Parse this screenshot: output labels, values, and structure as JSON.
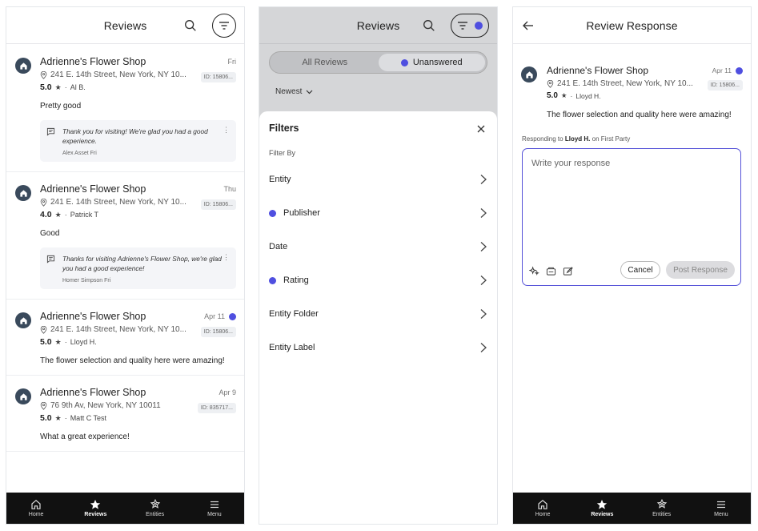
{
  "colors": {
    "accent": "#4f4fe0",
    "nav_bg": "#111111",
    "avatar_bg": "#3a4a5c"
  },
  "nav": [
    {
      "label": "Home",
      "icon": "home-icon"
    },
    {
      "label": "Reviews",
      "icon": "star-icon",
      "active": true
    },
    {
      "label": "Entities",
      "icon": "entities-icon"
    },
    {
      "label": "Menu",
      "icon": "menu-icon"
    }
  ],
  "list_screen": {
    "title": "Reviews",
    "reviews": [
      {
        "name": "Adrienne's Flower Shop",
        "date": "Fri",
        "address": "241 E. 14th Street, New York, NY 10...",
        "id": "ID: 15806...",
        "rating": "5.0",
        "author": "Al B.",
        "text": "Pretty good",
        "reply": {
          "text": "Thank you for visiting! We're glad you had a good experience.",
          "author": "Alex Asset",
          "date": "Fri"
        }
      },
      {
        "name": "Adrienne's Flower Shop",
        "date": "Thu",
        "address": "241 E. 14th Street, New York, NY 10...",
        "id": "ID: 15806...",
        "rating": "4.0",
        "author": "Patrick T",
        "text": "Good",
        "reply": {
          "text": "Thanks for visiting Adrienne's Flower Shop, we're glad you had a good experience!",
          "author": "Homer Simpson",
          "date": "Fri"
        }
      },
      {
        "name": "Adrienne's Flower Shop",
        "date": "Apr 11",
        "unread": true,
        "address": "241 E. 14th Street, New York, NY 10...",
        "id": "ID: 15806...",
        "rating": "5.0",
        "author": "Lloyd H.",
        "text": "The flower selection and quality here were amazing!"
      },
      {
        "name": "Adrienne's Flower Shop",
        "date": "Apr 9",
        "address": "76 9th Av, New York, NY 10011",
        "id": "ID: 835717...",
        "rating": "5.0",
        "author": "Matt C Test",
        "text": "What a great experience!"
      }
    ]
  },
  "filter_screen": {
    "title": "Reviews",
    "segments": [
      "All Reviews",
      "Unanswered"
    ],
    "sort": "Newest",
    "sheet_title": "Filters",
    "filter_by": "Filter By",
    "filters": [
      {
        "label": "Entity",
        "active": false
      },
      {
        "label": "Publisher",
        "active": true
      },
      {
        "label": "Date",
        "active": false
      },
      {
        "label": "Rating",
        "active": true
      },
      {
        "label": "Entity Folder",
        "active": false
      },
      {
        "label": "Entity Label",
        "active": false
      }
    ]
  },
  "response_screen": {
    "title": "Review Response",
    "review": {
      "name": "Adrienne's Flower Shop",
      "date": "Apr 11",
      "address": "241 E. 14th Street, New York, NY 10...",
      "id": "ID: 15806...",
      "rating": "5.0",
      "author": "Lloyd H.",
      "text": "The flower selection and quality here were amazing!"
    },
    "responding_prefix": "Responding to",
    "responding_name": "Lloyd H.",
    "responding_suffix": "on First Party",
    "placeholder": "Write your response",
    "cancel": "Cancel",
    "post": "Post Response"
  }
}
